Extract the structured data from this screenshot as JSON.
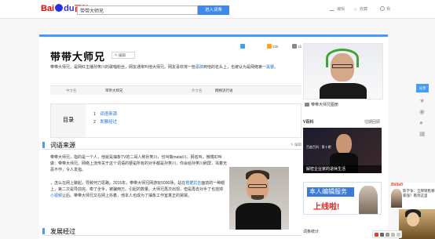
{
  "header": {
    "logo": {
      "bai": "Bai",
      "du": "du",
      "baike": "百科"
    },
    "search_value": "带带大师兄",
    "search_button": "进入词条",
    "edit_label": "编辑",
    "fav_label": "收藏",
    "me_label": "我"
  },
  "article": {
    "title": "带带大师兄",
    "edit_label": "编辑",
    "stats": {
      "favorites": "",
      "likes": "236",
      "shares": "16"
    },
    "summary_prefix": "带带大师兄，是网红主播孙笑川的歌唱粉丝，网友通常叫他大师兄。网友喜欢将一些",
    "summary_link1": "恶搞",
    "summary_mid": "到他的名头上，也被认为是网络第一",
    "summary_link2": "黑梗",
    "summary_suffix": "。",
    "info": {
      "cn_name_label": "中文名",
      "cn_name_value": "带带大师兄",
      "type_label": "外文名",
      "type_value": "网络流行语"
    },
    "toc": {
      "label": "目录",
      "items": [
        {
          "num": "1",
          "text": "词语来源"
        },
        {
          "num": "2",
          "text": "发展经过"
        }
      ]
    },
    "sections": [
      {
        "title": "词语来源",
        "edit": "编辑"
      },
      {
        "title": "发展经过",
        "edit": ""
      }
    ],
    "para1_a": "带带大师兄，指的是一个人，他就是抽象TV的二哥人称孙笑川，也叫做matal川，网名叫，微博ID叫做：带带大师兄。网络上流传关于这个词语的梗是所有的对手都是孙笑川，你会给孙笑川刷屏，骂着无恶不作，令人发指。",
    "para2_a": "因为matal川以前在直播时到处喊要家族的说法",
    "para2_link1": "说法",
    "para2_b": "，怎么在网上聊起，导致何刀思路。2015年，带带大师兄网游玩5000场，站在",
    "para2_link2": "根据抗击",
    "para2_c": "面前的一种眼上，第二次是导前完、牵了全手，被骗两万。引起的数量。大师兄再次出现，但是再去对手了也挂掉",
    "para2_link3": "小视频",
    "para2_d": "让后。带带大师兄又在网上抖着，他本人也成为了抽象工作室真正的舅舅。"
  },
  "sidebar": {
    "photo_caption": "带带大师兄图册",
    "vbaike_label": "V百科",
    "vbaike_more": "往期回顾",
    "banner_tag": "百度百科 · 第十期",
    "banner_caption": "解密企业家的退休生活",
    "ad_line1": "本人编辑服务",
    "ad_line2": "上线啦!",
    "stat_label": "词条统计"
  },
  "floating": {
    "share": "分享"
  },
  "promo": {
    "brand": "Bilibili",
    "text": "陈学争：全牌销售哪家强？看到这里"
  },
  "colors": {
    "accent": "#459df5",
    "link": "#136ec2",
    "search_button": "#3f89ec",
    "logo_red": "#e10601"
  }
}
